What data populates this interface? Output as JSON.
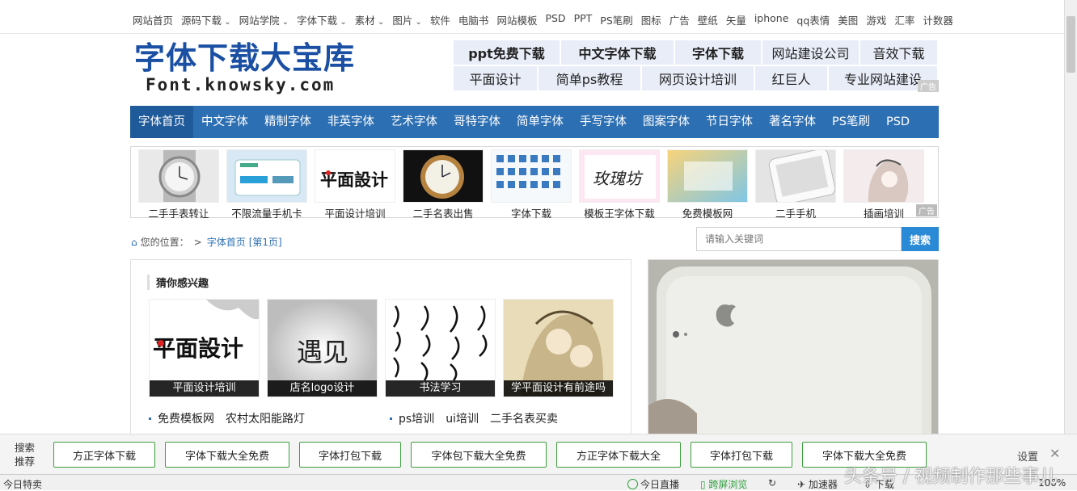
{
  "topnav": {
    "items": [
      {
        "label": "网站首页",
        "dd": false
      },
      {
        "label": "源码下载",
        "dd": true
      },
      {
        "label": "网站学院",
        "dd": true
      },
      {
        "label": "字体下载",
        "dd": true
      },
      {
        "label": "素材",
        "dd": true
      },
      {
        "label": "图片",
        "dd": true
      },
      {
        "label": "软件",
        "dd": false
      },
      {
        "label": "电脑书",
        "dd": false
      },
      {
        "label": "网站模板",
        "dd": false
      },
      {
        "label": "PSD",
        "dd": false
      },
      {
        "label": "PPT",
        "dd": false
      },
      {
        "label": "PS笔刷",
        "dd": false
      },
      {
        "label": "图标",
        "dd": false
      },
      {
        "label": "广告",
        "dd": false
      },
      {
        "label": "壁纸",
        "dd": false
      },
      {
        "label": "矢量",
        "dd": false
      },
      {
        "label": "iphone",
        "dd": false
      },
      {
        "label": "qq表情",
        "dd": false
      },
      {
        "label": "美图",
        "dd": false
      },
      {
        "label": "游戏",
        "dd": false
      },
      {
        "label": "汇率",
        "dd": false
      },
      {
        "label": "计数器",
        "dd": false
      }
    ]
  },
  "logo": {
    "line1": "字体下载大宝库",
    "line2": "Font.knowsky.com"
  },
  "adlinks": {
    "row1": [
      "ppt免费下载",
      "中文字体下载",
      "字体下载",
      "网站建设公司",
      "音效下载"
    ],
    "row2": [
      "平面设计",
      "简单ps教程",
      "网页设计培训",
      "红巨人",
      "专业网站建设"
    ],
    "tag": "广告"
  },
  "mainnav": [
    "字体首页",
    "中文字体",
    "精制字体",
    "非英字体",
    "艺术字体",
    "哥特字体",
    "简单字体",
    "手写字体",
    "图案字体",
    "节日字体",
    "著名字体",
    "PS笔刷",
    "PSD"
  ],
  "thumbs": {
    "items": [
      "二手手表转让",
      "不限流量手机卡",
      "平面设计培训",
      "二手名表出售",
      "字体下载",
      "模板王字体下载",
      "免费模板网",
      "二手手机",
      "插画培训"
    ],
    "tag": "广告",
    "art_text_1": "平面設计",
    "art_text_2": "玫瑰坊"
  },
  "breadcrumb": {
    "prefix": "您的位置：",
    "sep": ">",
    "link": "字体首页",
    "page": "[第1页]"
  },
  "search": {
    "placeholder": "请输入关键词",
    "button": "搜索"
  },
  "panel": {
    "title": "猜你感兴趣",
    "images": [
      "平面设计培训",
      "店名logo设计",
      "书法学习",
      "学平面设计有前途吗"
    ],
    "img_text_1": "平面設计",
    "img_text_2": "遇见",
    "links_left": [
      "免费模板网",
      "农村太阳能路灯"
    ],
    "links_right": [
      "ps培训",
      "ui培训",
      "二手名表买卖"
    ]
  },
  "recbar": {
    "label": "搜索推荐",
    "buttons": [
      "方正字体下载",
      "字体下载大全免费",
      "字体打包下载",
      "字体包下载大全免费",
      "方正字体下载大全",
      "字体打包下载",
      "字体下载大全免费"
    ],
    "settings": "设置",
    "close": "✕"
  },
  "status": {
    "left": "今日特卖",
    "live": "今日直播",
    "cross": "跨屏浏览",
    "accel": "加速器",
    "download": "下载",
    "zoom": "100%"
  },
  "watermark": "头条号 / 视频制作那些事儿"
}
